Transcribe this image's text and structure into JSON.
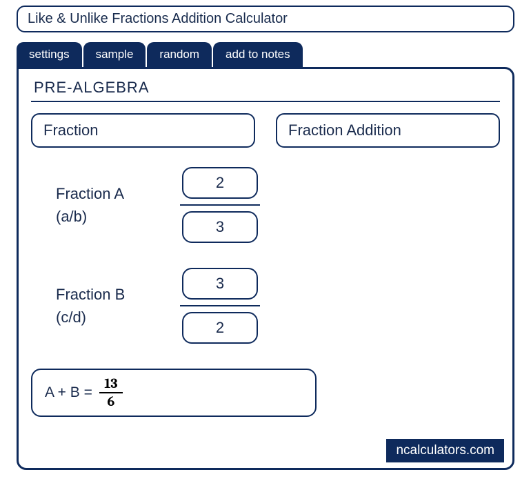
{
  "title": "Like & Unlike Fractions Addition Calculator",
  "tabs": {
    "settings": "settings",
    "sample": "sample",
    "random": "random",
    "notes": "add to notes"
  },
  "section_title": "PRE-ALGEBRA",
  "select1": "Fraction",
  "select2": "Fraction Addition",
  "fractionA": {
    "label_line1": "Fraction A",
    "label_line2": "(a/b)",
    "numerator": "2",
    "denominator": "3"
  },
  "fractionB": {
    "label_line1": "Fraction B",
    "label_line2": "(c/d)",
    "numerator": "3",
    "denominator": "2"
  },
  "result": {
    "label": "A + B  =",
    "numerator": "13",
    "denominator": "6"
  },
  "watermark": "ncalculators.com"
}
